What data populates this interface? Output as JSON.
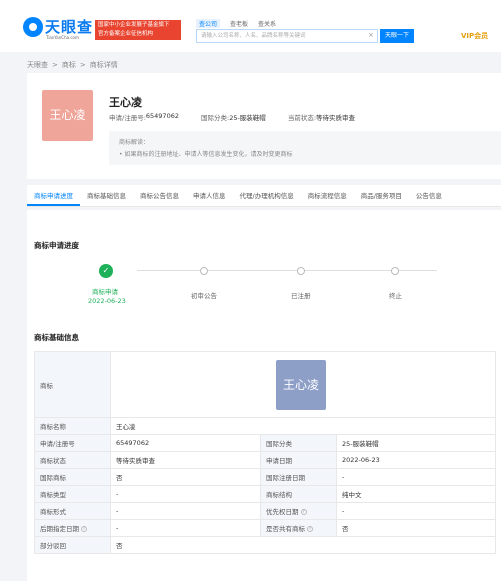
{
  "header": {
    "logo_text": "天眼查",
    "logo_sub": "TianYanCha.com",
    "gov_badge_line1": "国家中小企业发展子基金旗下",
    "gov_badge_line2": "官方备案企业征信机构",
    "search_tabs": [
      "查公司",
      "查老板",
      "查关系"
    ],
    "search_placeholder": "请输入公司名称、人名、品牌名称等关键词",
    "search_button": "天眼一下",
    "vip_label": "VIP会员"
  },
  "breadcrumb": [
    "天眼查",
    "商标",
    "商标详情"
  ],
  "trademark": {
    "logo_text": "王心凌",
    "name": "王心凌",
    "reg_no_label": "申请/注册号:",
    "reg_no": "65497062",
    "class_label": "国际分类:",
    "class_value": "25-服装鞋帽",
    "status_label": "当前状态:",
    "status_value": "等待实质审查",
    "tip_title": "商标解读：",
    "tip_text": "• 如果商标的注册地址、申请人等信息发生变化，请及时变更商标"
  },
  "tabs": [
    "商标申请进度",
    "商标基础信息",
    "商标公告信息",
    "申请人信息",
    "代理/办理机构信息",
    "商标流程信息",
    "商品/服务项目",
    "公告信息"
  ],
  "progress": {
    "title": "商标申请进度",
    "steps": [
      {
        "label": "商标申请",
        "date": "2022-06-23"
      },
      {
        "label": "初审公告"
      },
      {
        "label": "已注册"
      },
      {
        "label": "终止"
      }
    ]
  },
  "basic_info": {
    "title": "商标基础信息",
    "logo_label": "商标",
    "rows": [
      {
        "k1": "商标名称",
        "v1": "王心凌",
        "k2": "",
        "v2": ""
      },
      {
        "k1": "申请/注册号",
        "v1": "65497062",
        "k2": "国际分类",
        "v2": "25-服装鞋帽"
      },
      {
        "k1": "商标状态",
        "v1": "等待实质审查",
        "k2": "申请日期",
        "v2": "2022-06-23"
      },
      {
        "k1": "国际商标",
        "v1": "否",
        "k2": "国际注册日期",
        "v2": "-"
      },
      {
        "k1": "商标类型",
        "v1": "-",
        "k2": "商标结构",
        "v2": "纯中文"
      },
      {
        "k1": "商标形式",
        "v1": "-",
        "k2": "优先权日期",
        "v2": "-"
      },
      {
        "k1": "后期指定日期",
        "v1": "-",
        "k2": "是否共有商标",
        "v2": "否"
      },
      {
        "k1": "部分驳回",
        "v1": "否",
        "k2": "",
        "v2": ""
      }
    ]
  }
}
